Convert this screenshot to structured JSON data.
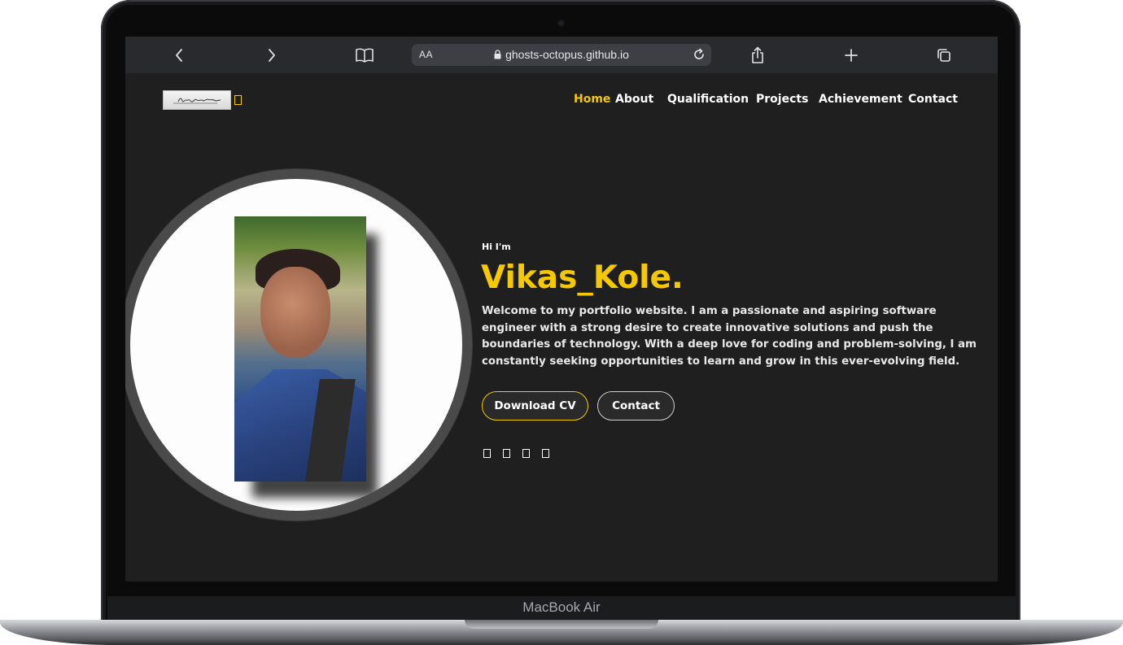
{
  "device": {
    "label": "MacBook Air"
  },
  "browser": {
    "address_prefix": "AA",
    "url": "ghosts-octopus.github.io"
  },
  "site": {
    "logo_alt": "Vikas Kole signature logo",
    "nav": [
      "Home",
      "About",
      "Qualification",
      "Projects",
      "Achievement",
      "Contact"
    ],
    "active_nav": "Home",
    "greeting": "Hi I'm",
    "name": "Vikas_Kole.",
    "intro": "Welcome to my portfolio website. I am a passionate and aspiring software engineer with a strong desire to create innovative solutions and push the boundaries of technology. With a deep love for coding and problem-solving, I am constantly seeking opportunities to learn and grow in this ever-evolving field.",
    "buttons": {
      "download_cv": "Download CV",
      "contact": "Contact"
    },
    "social_icons": [
      "social-icon-1",
      "social-icon-2",
      "social-icon-3",
      "social-icon-4"
    ]
  },
  "colors": {
    "accent": "#f5c800",
    "page_background": "#1f1f1f",
    "toolbar": "#282a2e"
  }
}
